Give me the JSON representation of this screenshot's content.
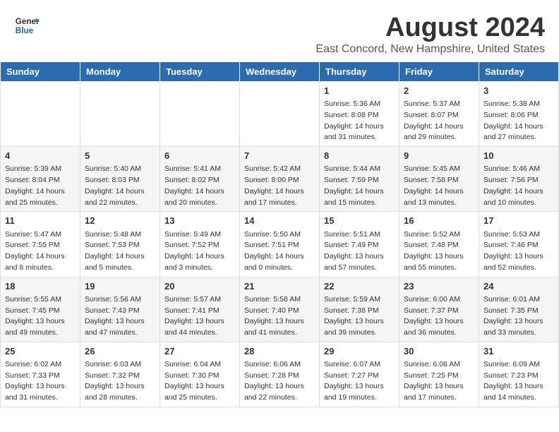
{
  "header": {
    "logo_general": "General",
    "logo_blue": "Blue",
    "month_year": "August 2024",
    "location": "East Concord, New Hampshire, United States"
  },
  "weekdays": [
    "Sunday",
    "Monday",
    "Tuesday",
    "Wednesday",
    "Thursday",
    "Friday",
    "Saturday"
  ],
  "weeks": [
    [
      {
        "day": "",
        "info": ""
      },
      {
        "day": "",
        "info": ""
      },
      {
        "day": "",
        "info": ""
      },
      {
        "day": "",
        "info": ""
      },
      {
        "day": "1",
        "info": "Sunrise: 5:36 AM\nSunset: 8:08 PM\nDaylight: 14 hours\nand 31 minutes."
      },
      {
        "day": "2",
        "info": "Sunrise: 5:37 AM\nSunset: 8:07 PM\nDaylight: 14 hours\nand 29 minutes."
      },
      {
        "day": "3",
        "info": "Sunrise: 5:38 AM\nSunset: 8:06 PM\nDaylight: 14 hours\nand 27 minutes."
      }
    ],
    [
      {
        "day": "4",
        "info": "Sunrise: 5:39 AM\nSunset: 8:04 PM\nDaylight: 14 hours\nand 25 minutes."
      },
      {
        "day": "5",
        "info": "Sunrise: 5:40 AM\nSunset: 8:03 PM\nDaylight: 14 hours\nand 22 minutes."
      },
      {
        "day": "6",
        "info": "Sunrise: 5:41 AM\nSunset: 8:02 PM\nDaylight: 14 hours\nand 20 minutes."
      },
      {
        "day": "7",
        "info": "Sunrise: 5:42 AM\nSunset: 8:00 PM\nDaylight: 14 hours\nand 17 minutes."
      },
      {
        "day": "8",
        "info": "Sunrise: 5:44 AM\nSunset: 7:59 PM\nDaylight: 14 hours\nand 15 minutes."
      },
      {
        "day": "9",
        "info": "Sunrise: 5:45 AM\nSunset: 7:58 PM\nDaylight: 14 hours\nand 13 minutes."
      },
      {
        "day": "10",
        "info": "Sunrise: 5:46 AM\nSunset: 7:56 PM\nDaylight: 14 hours\nand 10 minutes."
      }
    ],
    [
      {
        "day": "11",
        "info": "Sunrise: 5:47 AM\nSunset: 7:55 PM\nDaylight: 14 hours\nand 8 minutes."
      },
      {
        "day": "12",
        "info": "Sunrise: 5:48 AM\nSunset: 7:53 PM\nDaylight: 14 hours\nand 5 minutes."
      },
      {
        "day": "13",
        "info": "Sunrise: 5:49 AM\nSunset: 7:52 PM\nDaylight: 14 hours\nand 3 minutes."
      },
      {
        "day": "14",
        "info": "Sunrise: 5:50 AM\nSunset: 7:51 PM\nDaylight: 14 hours\nand 0 minutes."
      },
      {
        "day": "15",
        "info": "Sunrise: 5:51 AM\nSunset: 7:49 PM\nDaylight: 13 hours\nand 57 minutes."
      },
      {
        "day": "16",
        "info": "Sunrise: 5:52 AM\nSunset: 7:48 PM\nDaylight: 13 hours\nand 55 minutes."
      },
      {
        "day": "17",
        "info": "Sunrise: 5:53 AM\nSunset: 7:46 PM\nDaylight: 13 hours\nand 52 minutes."
      }
    ],
    [
      {
        "day": "18",
        "info": "Sunrise: 5:55 AM\nSunset: 7:45 PM\nDaylight: 13 hours\nand 49 minutes."
      },
      {
        "day": "19",
        "info": "Sunrise: 5:56 AM\nSunset: 7:43 PM\nDaylight: 13 hours\nand 47 minutes."
      },
      {
        "day": "20",
        "info": "Sunrise: 5:57 AM\nSunset: 7:41 PM\nDaylight: 13 hours\nand 44 minutes."
      },
      {
        "day": "21",
        "info": "Sunrise: 5:58 AM\nSunset: 7:40 PM\nDaylight: 13 hours\nand 41 minutes."
      },
      {
        "day": "22",
        "info": "Sunrise: 5:59 AM\nSunset: 7:38 PM\nDaylight: 13 hours\nand 39 minutes."
      },
      {
        "day": "23",
        "info": "Sunrise: 6:00 AM\nSunset: 7:37 PM\nDaylight: 13 hours\nand 36 minutes."
      },
      {
        "day": "24",
        "info": "Sunrise: 6:01 AM\nSunset: 7:35 PM\nDaylight: 13 hours\nand 33 minutes."
      }
    ],
    [
      {
        "day": "25",
        "info": "Sunrise: 6:02 AM\nSunset: 7:33 PM\nDaylight: 13 hours\nand 31 minutes."
      },
      {
        "day": "26",
        "info": "Sunrise: 6:03 AM\nSunset: 7:32 PM\nDaylight: 13 hours\nand 28 minutes."
      },
      {
        "day": "27",
        "info": "Sunrise: 6:04 AM\nSunset: 7:30 PM\nDaylight: 13 hours\nand 25 minutes."
      },
      {
        "day": "28",
        "info": "Sunrise: 6:06 AM\nSunset: 7:28 PM\nDaylight: 13 hours\nand 22 minutes."
      },
      {
        "day": "29",
        "info": "Sunrise: 6:07 AM\nSunset: 7:27 PM\nDaylight: 13 hours\nand 19 minutes."
      },
      {
        "day": "30",
        "info": "Sunrise: 6:08 AM\nSunset: 7:25 PM\nDaylight: 13 hours\nand 17 minutes."
      },
      {
        "day": "31",
        "info": "Sunrise: 6:09 AM\nSunset: 7:23 PM\nDaylight: 13 hours\nand 14 minutes."
      }
    ]
  ]
}
